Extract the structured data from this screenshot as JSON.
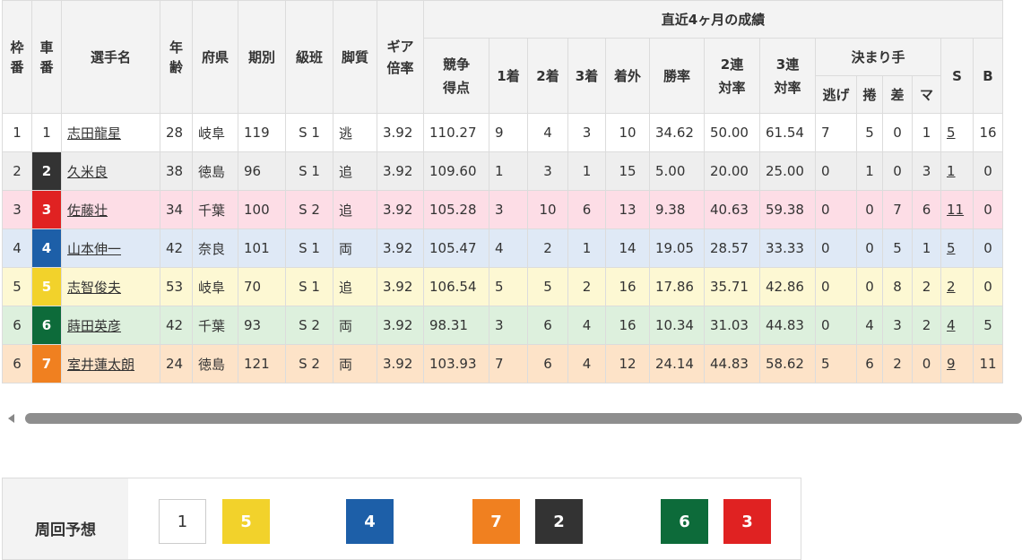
{
  "headers": {
    "waku": "枠番",
    "sha": "車番",
    "name": "選手名",
    "age": "年齢",
    "pref": "府県",
    "period": "期別",
    "class": "級班",
    "leg": "脚質",
    "gear": "ギア倍率",
    "recent": "直近4ヶ月の成績",
    "score": "競争得点",
    "first": "1着",
    "second": "2着",
    "third": "3着",
    "out": "着外",
    "win_rate": "勝率",
    "quinella": "2連対率",
    "trio": "3連対率",
    "kimarite": "決まり手",
    "nige": "逃げ",
    "makuri": "捲",
    "sashi": "差",
    "mark": "マ",
    "s": "S",
    "b": "B"
  },
  "colors": {
    "row_bg": [
      "#ffffff",
      "#eeeeee",
      "#fddde6",
      "#dfe9f6",
      "#fdf8d3",
      "#ddf0dd",
      "#fde3c8"
    ],
    "bib_bg": [
      "#ffffff",
      "#333333",
      "#e02222",
      "#1d5fa8",
      "#f2d22b",
      "#0d6b3a",
      "#f08020"
    ],
    "bib_fg": [
      "#333333",
      "#ffffff",
      "#ffffff",
      "#ffffff",
      "#ffffff",
      "#ffffff",
      "#ffffff"
    ]
  },
  "riders": [
    {
      "waku": "1",
      "sha": "1",
      "name": "志田龍星",
      "age": "28",
      "pref": "岐阜",
      "period": "119",
      "class": "S 1",
      "leg": "逃",
      "gear": "3.92",
      "score": "110.27",
      "first": "9",
      "second": "4",
      "third": "3",
      "out": "10",
      "win_rate": "34.62",
      "quinella": "50.00",
      "trio": "61.54",
      "nige": "7",
      "makuri": "5",
      "sashi": "0",
      "mark": "1",
      "s": "5",
      "b": "16"
    },
    {
      "waku": "2",
      "sha": "2",
      "name": "久米良",
      "age": "38",
      "pref": "徳島",
      "period": "96",
      "class": "S 1",
      "leg": "追",
      "gear": "3.92",
      "score": "109.60",
      "first": "1",
      "second": "3",
      "third": "1",
      "out": "15",
      "win_rate": "5.00",
      "quinella": "20.00",
      "trio": "25.00",
      "nige": "0",
      "makuri": "1",
      "sashi": "0",
      "mark": "3",
      "s": "1",
      "b": "0"
    },
    {
      "waku": "3",
      "sha": "3",
      "name": "佐藤壮",
      "age": "34",
      "pref": "千葉",
      "period": "100",
      "class": "S 2",
      "leg": "追",
      "gear": "3.92",
      "score": "105.28",
      "first": "3",
      "second": "10",
      "third": "6",
      "out": "13",
      "win_rate": "9.38",
      "quinella": "40.63",
      "trio": "59.38",
      "nige": "0",
      "makuri": "0",
      "sashi": "7",
      "mark": "6",
      "s": "11",
      "b": "0"
    },
    {
      "waku": "4",
      "sha": "4",
      "name": "山本伸一",
      "age": "42",
      "pref": "奈良",
      "period": "101",
      "class": "S 1",
      "leg": "両",
      "gear": "3.92",
      "score": "105.47",
      "first": "4",
      "second": "2",
      "third": "1",
      "out": "14",
      "win_rate": "19.05",
      "quinella": "28.57",
      "trio": "33.33",
      "nige": "0",
      "makuri": "0",
      "sashi": "5",
      "mark": "1",
      "s": "5",
      "b": "0"
    },
    {
      "waku": "5",
      "sha": "5",
      "name": "志智俊夫",
      "age": "53",
      "pref": "岐阜",
      "period": "70",
      "class": "S 1",
      "leg": "追",
      "gear": "3.92",
      "score": "106.54",
      "first": "5",
      "second": "5",
      "third": "2",
      "out": "16",
      "win_rate": "17.86",
      "quinella": "35.71",
      "trio": "42.86",
      "nige": "0",
      "makuri": "0",
      "sashi": "8",
      "mark": "2",
      "s": "2",
      "b": "0"
    },
    {
      "waku": "6",
      "sha": "6",
      "name": "蒔田英彦",
      "age": "42",
      "pref": "千葉",
      "period": "93",
      "class": "S 2",
      "leg": "両",
      "gear": "3.92",
      "score": "98.31",
      "first": "3",
      "second": "6",
      "third": "4",
      "out": "16",
      "win_rate": "10.34",
      "quinella": "31.03",
      "trio": "44.83",
      "nige": "0",
      "makuri": "4",
      "sashi": "3",
      "mark": "2",
      "s": "4",
      "b": "5"
    },
    {
      "waku": "6",
      "sha": "7",
      "name": "室井蓮太朗",
      "age": "24",
      "pref": "徳島",
      "period": "121",
      "class": "S 2",
      "leg": "両",
      "gear": "3.92",
      "score": "103.93",
      "first": "7",
      "second": "6",
      "third": "4",
      "out": "12",
      "win_rate": "24.14",
      "quinella": "44.83",
      "trio": "58.62",
      "nige": "5",
      "makuri": "6",
      "sashi": "2",
      "mark": "0",
      "s": "9",
      "b": "11"
    }
  ],
  "prediction": {
    "label": "周回予想",
    "boxes": [
      {
        "num": "1",
        "bg": "#ffffff",
        "fg": "#333333"
      },
      {
        "num": "5",
        "bg": "#f2d22b",
        "fg": "#ffffff"
      },
      {
        "num": "4",
        "bg": "#1d5fa8",
        "fg": "#ffffff"
      },
      {
        "num": "7",
        "bg": "#f08020",
        "fg": "#ffffff"
      },
      {
        "num": "2",
        "bg": "#333333",
        "fg": "#ffffff"
      },
      {
        "num": "6",
        "bg": "#0d6b3a",
        "fg": "#ffffff"
      },
      {
        "num": "3",
        "bg": "#e02222",
        "fg": "#ffffff"
      }
    ]
  }
}
